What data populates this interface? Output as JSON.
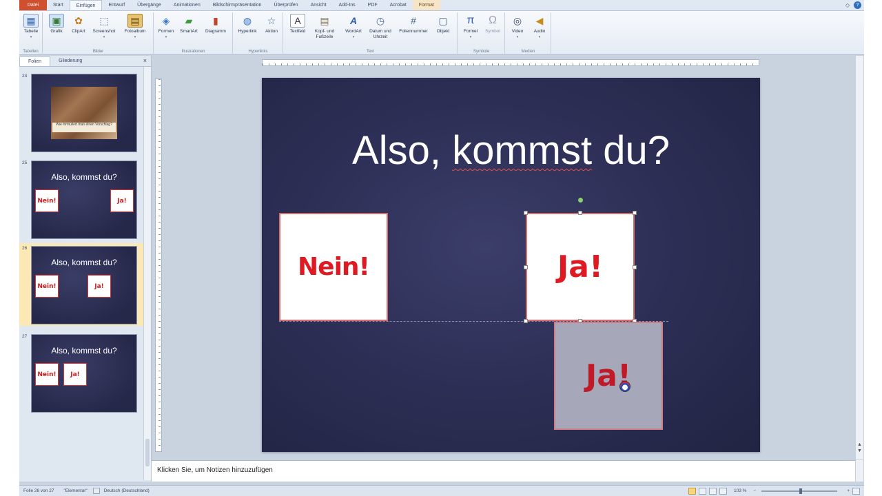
{
  "ribbon_tabs": [
    {
      "label": "Datei"
    },
    {
      "label": "Start"
    },
    {
      "label": "Einfügen"
    },
    {
      "label": "Entwurf"
    },
    {
      "label": "Übergänge"
    },
    {
      "label": "Animationen"
    },
    {
      "label": "Bildschirmpräsentation"
    },
    {
      "label": "Überprüfen"
    },
    {
      "label": "Ansicht"
    },
    {
      "label": "Add-Ins"
    },
    {
      "label": "PDF"
    },
    {
      "label": "Acrobat"
    },
    {
      "label": "Format"
    }
  ],
  "active_tab": "Einfügen",
  "ribbon_groups": [
    {
      "label": "Tabellen",
      "commands": [
        {
          "label": "Tabelle",
          "icon": "table-icon"
        }
      ]
    },
    {
      "label": "Bilder",
      "commands": [
        {
          "label": "Grafik",
          "icon": "picture-icon"
        },
        {
          "label": "ClipArt",
          "icon": "clipart-icon"
        },
        {
          "label": "Screenshot",
          "icon": "screenshot-icon"
        },
        {
          "label": "Fotoalbum",
          "icon": "photo-album-icon"
        }
      ]
    },
    {
      "label": "Illustrationen",
      "commands": [
        {
          "label": "Formen",
          "icon": "shapes-icon"
        },
        {
          "label": "SmartArt",
          "icon": "smartart-icon"
        },
        {
          "label": "Diagramm",
          "icon": "chart-icon"
        }
      ]
    },
    {
      "label": "Hyperlinks",
      "commands": [
        {
          "label": "Hyperlink",
          "icon": "hyperlink-icon"
        },
        {
          "label": "Aktion",
          "icon": "action-icon"
        }
      ]
    },
    {
      "label": "Text",
      "commands": [
        {
          "label": "Textfeld",
          "icon": "textbox-icon"
        },
        {
          "label": "Kopf- und Fußzeile",
          "icon": "header-footer-icon"
        },
        {
          "label": "WordArt",
          "icon": "wordart-icon"
        },
        {
          "label": "Datum und Uhrzeit",
          "icon": "date-time-icon"
        },
        {
          "label": "Foliennummer",
          "icon": "slide-number-icon"
        },
        {
          "label": "Objekt",
          "icon": "object-icon"
        }
      ]
    },
    {
      "label": "Symbole",
      "commands": [
        {
          "label": "Formel",
          "icon": "formula-icon"
        },
        {
          "label": "Symbol",
          "icon": "symbol-icon"
        }
      ]
    },
    {
      "label": "Medien",
      "commands": [
        {
          "label": "Video",
          "icon": "video-icon"
        },
        {
          "label": "Audio",
          "icon": "audio-icon"
        }
      ]
    }
  ],
  "panel": {
    "tabs": [
      "Folien",
      "Gliederung"
    ],
    "close": "×"
  },
  "thumbnails": [
    {
      "number": "24",
      "caption": "Wie formuliert man einen Vorschlag?"
    },
    {
      "number": "25",
      "title": "Also, kommst du?",
      "left_box": "Nein!",
      "right_box": "Ja!"
    },
    {
      "number": "26",
      "title": "Also, kommst du?",
      "left_box": "Nein!",
      "right_box": "Ja!"
    },
    {
      "number": "27",
      "title": "Also, kommst du?",
      "left_box": "Nein!",
      "right_box": "Ja!"
    }
  ],
  "selected_slide": "26",
  "slide": {
    "title_part1": "Also, ",
    "title_part2": "kommst",
    "title_part3": " du?",
    "box_left": "Nein!",
    "box_right": "Ja!",
    "box_ghost": "Ja!"
  },
  "notes_placeholder": "Klicken Sie, um Notizen hinzuzufügen",
  "status": {
    "slide_info": "Folie 26 von 27",
    "theme": "\"Elementar\"",
    "language": "Deutsch (Deutschland)",
    "zoom": "103 %"
  },
  "colors": {
    "file_tab": "#d04f2c",
    "slide_bg": "#2c2e55",
    "box_text": "#e01a22",
    "selected_thumb": "#fbe8b4"
  }
}
